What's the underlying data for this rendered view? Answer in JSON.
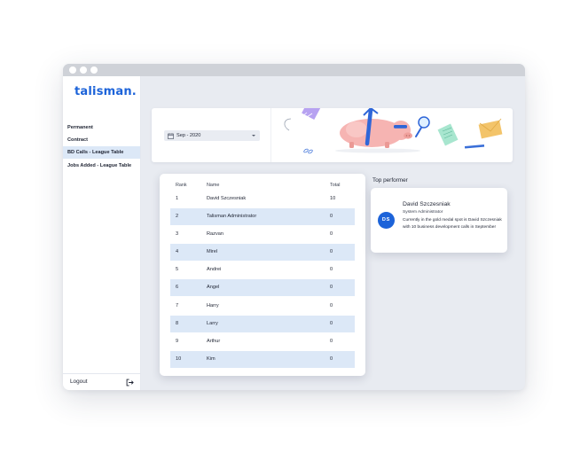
{
  "app": {
    "logo": "talisman.",
    "brand_color": "#1c63d9"
  },
  "sidebar": {
    "items": [
      {
        "label": "Permanent",
        "active": false
      },
      {
        "label": "Contract",
        "active": false
      },
      {
        "label": "BD Calls - League Table",
        "active": true
      },
      {
        "label": "Jobs Added - League Table",
        "active": false
      }
    ],
    "logout_label": "Logout"
  },
  "banner": {
    "date_value": "Sep - 2020"
  },
  "league_table": {
    "headers": {
      "rank": "Rank",
      "name": "Name",
      "total": "Total"
    },
    "rows": [
      {
        "rank": "1",
        "name": "David Szczesniak",
        "total": "10"
      },
      {
        "rank": "2",
        "name": "Talisman Administrator",
        "total": "0"
      },
      {
        "rank": "3",
        "name": "Razvan",
        "total": "0"
      },
      {
        "rank": "4",
        "name": "Mirel",
        "total": "0"
      },
      {
        "rank": "5",
        "name": "Andrei",
        "total": "0"
      },
      {
        "rank": "6",
        "name": "Angel",
        "total": "0"
      },
      {
        "rank": "7",
        "name": "Harry",
        "total": "0"
      },
      {
        "rank": "8",
        "name": "Larry",
        "total": "0"
      },
      {
        "rank": "9",
        "name": "Arthur",
        "total": "0"
      },
      {
        "rank": "10",
        "name": "Kim",
        "total": "0"
      }
    ]
  },
  "top_performer": {
    "section_title": "Top performer",
    "initials": "DS",
    "name": "David Szczesniak",
    "role": "System Administrator",
    "description": "Currently in the gold medal spot is David Szczesniak with 10 business development calls in September"
  }
}
